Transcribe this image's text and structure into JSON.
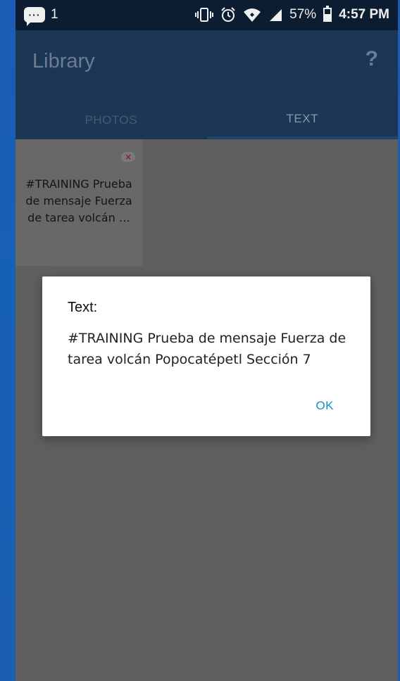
{
  "status_bar": {
    "notification_count": "1",
    "chat_icon_glyph": "···",
    "battery": "57%",
    "battery_level": 0.57,
    "time": "4:57 PM",
    "icons": [
      "chat-icon",
      "vibrate-icon",
      "alarm-icon",
      "wifi-icon",
      "signal-icon",
      "battery-icon"
    ]
  },
  "app_bar": {
    "title": "Library",
    "help_glyph": "?",
    "tabs": [
      {
        "label": "PHOTOS",
        "active": false
      },
      {
        "label": "TEXT",
        "active": true
      }
    ]
  },
  "library": {
    "items": [
      {
        "text": "#TRAINING Prueba de mensaje Fuerza de tarea volcán …",
        "close_glyph": "×"
      }
    ]
  },
  "dialog": {
    "title": "Text:",
    "body": "#TRAINING Prueba de mensaje Fuerza de tarea volcán Popocatépetl Sección 7",
    "ok_label": "OK"
  },
  "colors": {
    "status_bar": "#0c1d31",
    "app_bar": "#1c3656",
    "scrim": "#5f5f5f",
    "dialog_button": "#1e8ac8",
    "outer_background": "#1c5bb4"
  }
}
